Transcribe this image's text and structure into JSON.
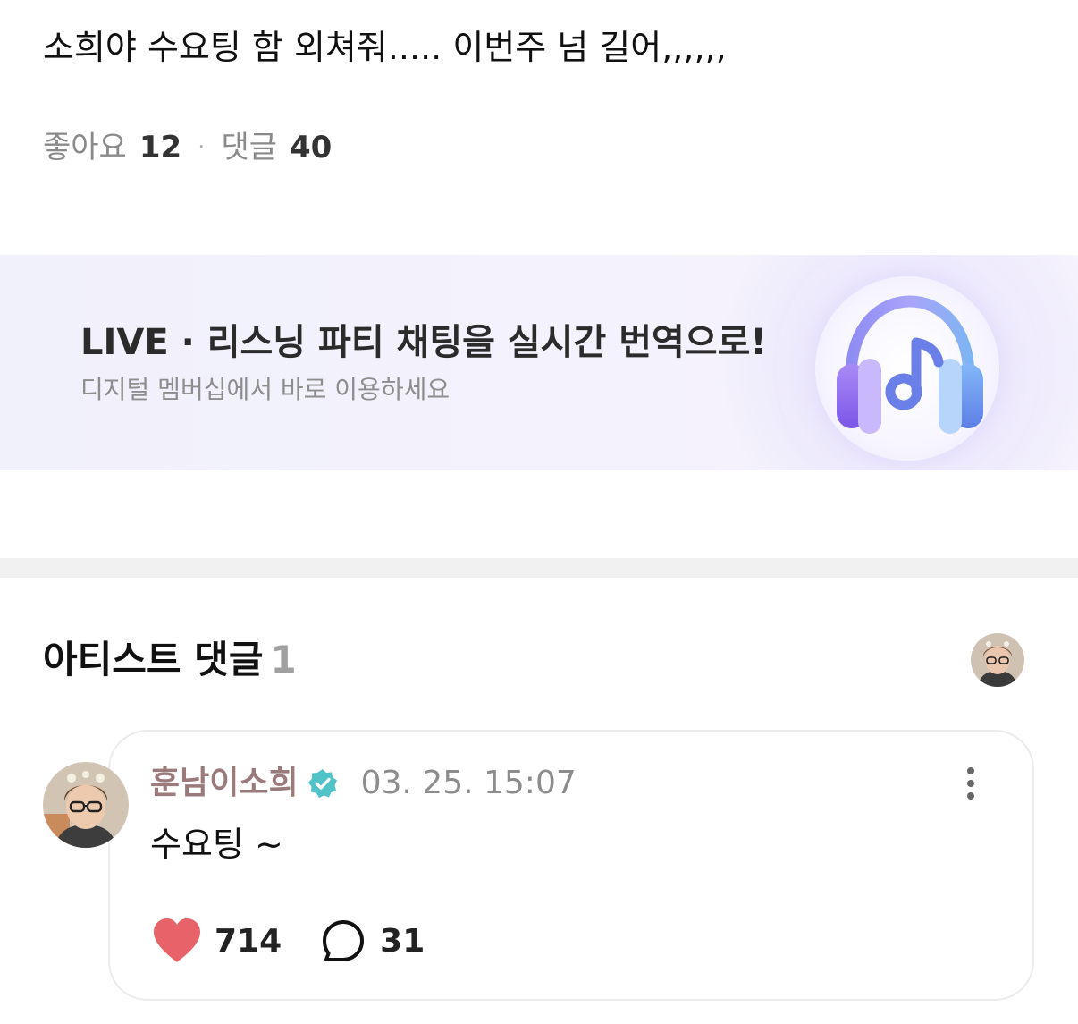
{
  "post": {
    "text": "소희야 수요팅 함 외쳐줘..... 이번주 넘 길어,,,,,,",
    "likes_label": "좋아요",
    "likes_count": "12",
    "separator": "·",
    "comments_label": "댓글",
    "comments_count": "40"
  },
  "banner": {
    "title": "LIVE · 리스닝 파티 채팅을 실시간 번역으로!",
    "subtitle": "디지털 멤버십에서 바로 이용하세요",
    "icon": "headphones-music-icon"
  },
  "artist_comments": {
    "title": "아티스트 댓글",
    "count": "1",
    "avatar": "artist-avatar"
  },
  "comment": {
    "author": "훈남이소희",
    "verified_icon": "verified-badge-icon",
    "timestamp": "03. 25. 15:07",
    "text": "수요팅 ~",
    "like_count": "714",
    "reply_count": "31",
    "like_icon": "heart-icon",
    "reply_icon": "speech-bubble-icon",
    "more_icon": "more-vertical-icon"
  },
  "colors": {
    "heart": "#e8626a",
    "verified": "#4fc3c8",
    "author": "#9a7a7a",
    "banner_bg": "#f3f1fb"
  }
}
